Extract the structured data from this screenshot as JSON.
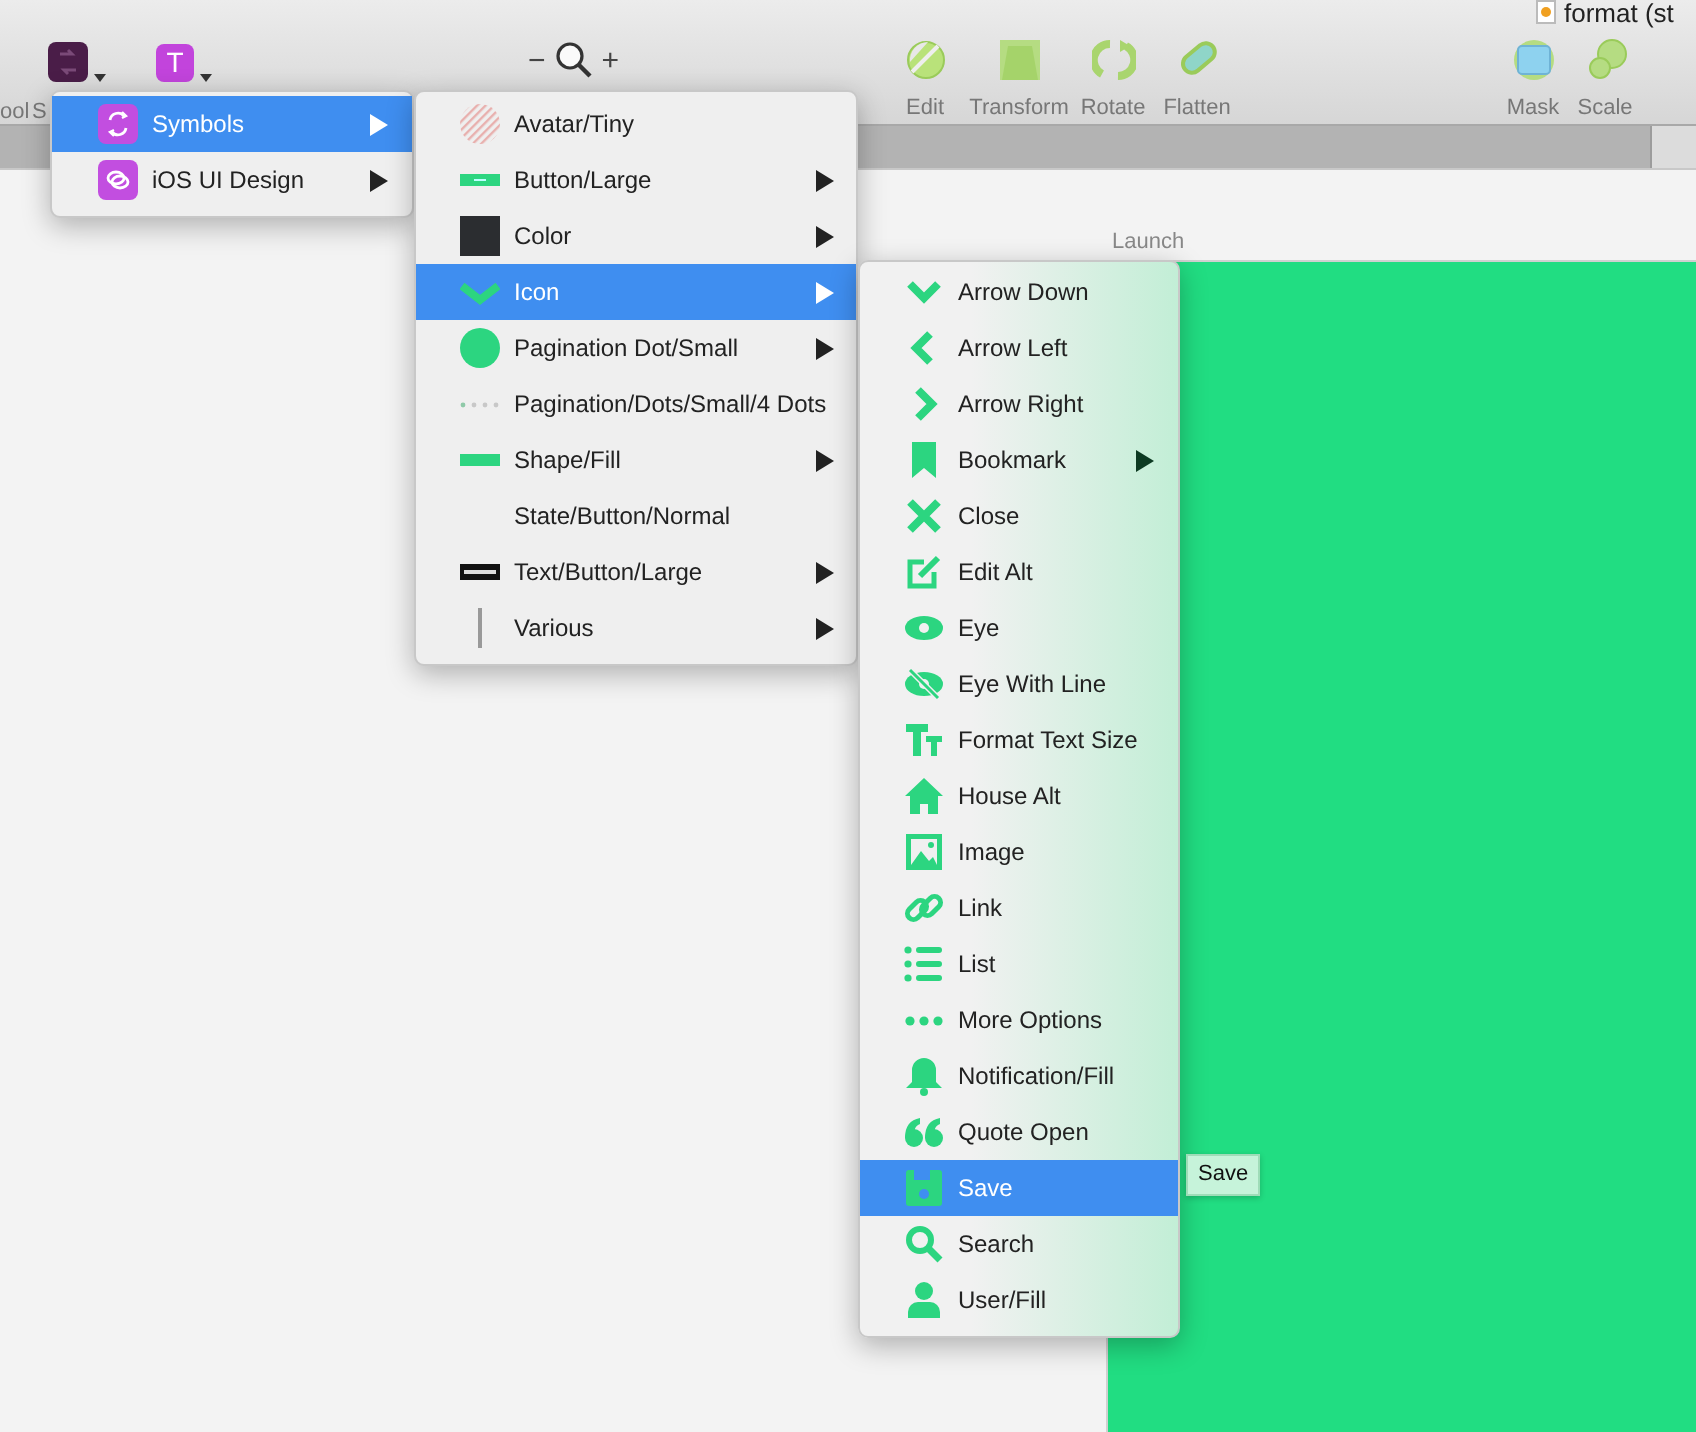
{
  "toolbar": {
    "document_title": "format (st",
    "cut_label": "ool",
    "symbols_button": {
      "label": "S"
    },
    "text_button": {
      "glyph": "T"
    },
    "zoom": {
      "minus": "−",
      "plus": "+"
    },
    "tools": [
      {
        "label": "Edit"
      },
      {
        "label": "Transform"
      },
      {
        "label": "Rotate"
      },
      {
        "label": "Flatten"
      }
    ],
    "tools_right": [
      {
        "label": "Mask"
      },
      {
        "label": "Scale"
      }
    ]
  },
  "canvas": {
    "artboard_label": "Launch"
  },
  "menus": [
    {
      "items": [
        {
          "label": "Symbols",
          "selected": true,
          "submenu": true
        },
        {
          "label": "iOS UI Design",
          "selected": false,
          "submenu": true
        }
      ]
    },
    {
      "items": [
        {
          "label": "Avatar/Tiny",
          "selected": false,
          "submenu": false
        },
        {
          "label": "Button/Large",
          "selected": false,
          "submenu": true
        },
        {
          "label": "Color",
          "selected": false,
          "submenu": true
        },
        {
          "label": "Icon",
          "selected": true,
          "submenu": true
        },
        {
          "label": "Pagination Dot/Small",
          "selected": false,
          "submenu": true
        },
        {
          "label": "Pagination/Dots/Small/4 Dots",
          "selected": false,
          "submenu": false
        },
        {
          "label": "Shape/Fill",
          "selected": false,
          "submenu": true
        },
        {
          "label": "State/Button/Normal",
          "selected": false,
          "submenu": false
        },
        {
          "label": "Text/Button/Large",
          "selected": false,
          "submenu": true
        },
        {
          "label": "Various",
          "selected": false,
          "submenu": true
        }
      ]
    },
    {
      "items": [
        {
          "label": "Arrow Down",
          "selected": false,
          "submenu": false
        },
        {
          "label": "Arrow Left",
          "selected": false,
          "submenu": false
        },
        {
          "label": "Arrow Right",
          "selected": false,
          "submenu": false
        },
        {
          "label": "Bookmark",
          "selected": false,
          "submenu": true
        },
        {
          "label": "Close",
          "selected": false,
          "submenu": false
        },
        {
          "label": "Edit Alt",
          "selected": false,
          "submenu": false
        },
        {
          "label": "Eye",
          "selected": false,
          "submenu": false
        },
        {
          "label": "Eye With Line",
          "selected": false,
          "submenu": false
        },
        {
          "label": "Format Text Size",
          "selected": false,
          "submenu": false
        },
        {
          "label": "House Alt",
          "selected": false,
          "submenu": false
        },
        {
          "label": "Image",
          "selected": false,
          "submenu": false
        },
        {
          "label": "Link",
          "selected": false,
          "submenu": false
        },
        {
          "label": "List",
          "selected": false,
          "submenu": false
        },
        {
          "label": "More Options",
          "selected": false,
          "submenu": false
        },
        {
          "label": "Notification/Fill",
          "selected": false,
          "submenu": false
        },
        {
          "label": "Quote Open",
          "selected": false,
          "submenu": false
        },
        {
          "label": "Save",
          "selected": true,
          "submenu": false
        },
        {
          "label": "Search",
          "selected": false,
          "submenu": false
        },
        {
          "label": "User/Fill",
          "selected": false,
          "submenu": false
        }
      ]
    }
  ],
  "tooltip": "Save"
}
